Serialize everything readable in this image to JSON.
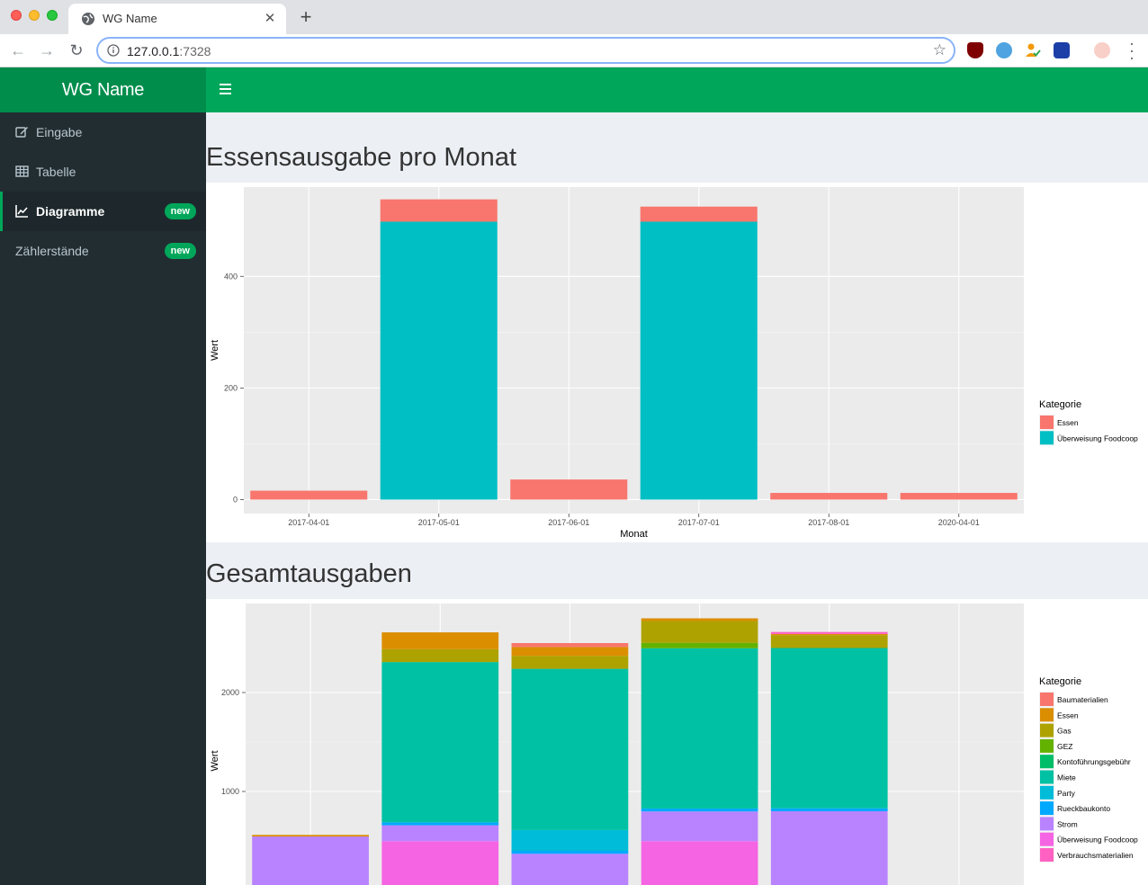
{
  "browser": {
    "tab_title": "WG Name",
    "tab_close": "✕",
    "new_tab": "+",
    "url_host": "127.0.0.1",
    "url_port": ":7328",
    "star": "☆"
  },
  "app": {
    "logo": "WG Name",
    "accent_color": "#00a65a",
    "sidebar_bg": "#222d32"
  },
  "sidebar": {
    "items": [
      {
        "label": "Eingabe",
        "icon": "edit-icon",
        "active": false,
        "badge": ""
      },
      {
        "label": "Tabelle",
        "icon": "table-icon",
        "active": false,
        "badge": ""
      },
      {
        "label": "Diagramme",
        "icon": "line-chart-icon",
        "active": true,
        "badge": "new"
      },
      {
        "label": "Zählerstände",
        "icon": "",
        "active": false,
        "badge": "new"
      }
    ]
  },
  "main": {
    "sections": [
      {
        "title": "Essensausgabe pro Monat"
      },
      {
        "title": "Gesamtausgaben"
      }
    ]
  },
  "chart_data": [
    {
      "type": "bar",
      "stacked": true,
      "title": "",
      "xlabel": "Monat",
      "ylabel": "Wert",
      "categories": [
        "2017-04-01",
        "2017-05-01",
        "2017-06-01",
        "2017-07-01",
        "2017-08-01",
        "2020-04-01"
      ],
      "yticks": [
        0,
        200,
        400
      ],
      "ylim": [
        -25,
        560
      ],
      "grid": true,
      "legend_position": "right",
      "legend_title": "Kategorie",
      "series": [
        {
          "name": "Überweisung Foodcoop",
          "color": "#00bfc4",
          "values": [
            0,
            498,
            0,
            498,
            0,
            0
          ]
        },
        {
          "name": "Essen",
          "color": "#f8766d",
          "values": [
            16,
            40,
            36,
            27,
            12,
            12
          ]
        }
      ]
    },
    {
      "type": "bar",
      "stacked": true,
      "title": "",
      "xlabel": "",
      "ylabel": "Wert",
      "categories": [
        "",
        "",
        "",
        "",
        "",
        ""
      ],
      "yticks": [
        1000,
        2000
      ],
      "ylim": [
        -100,
        2900
      ],
      "grid": true,
      "legend_position": "right",
      "legend_title": "Kategorie",
      "series": [
        {
          "name": "Verbrauchsmaterialien",
          "color": "#ff61c3",
          "values": [
            0,
            0,
            0,
            0,
            0,
            0
          ]
        },
        {
          "name": "Überweisung Foodcoop",
          "color": "#f564e3",
          "values": [
            0,
            498,
            0,
            498,
            0,
            0
          ]
        },
        {
          "name": "Strom",
          "color": "#b983ff",
          "values": [
            0,
            0,
            0,
            0,
            0,
            0
          ]
        },
        {
          "name": "Rueckbaukonto",
          "color": "#00a9ff",
          "values": [
            0,
            0,
            0,
            0,
            0,
            0
          ]
        },
        {
          "name": "Party",
          "color": "#00bcd8",
          "values": [
            0,
            0,
            0,
            0,
            0,
            0
          ]
        },
        {
          "name": "Miete",
          "color": "#00c1a3",
          "values": [
            0,
            0,
            0,
            0,
            0,
            0
          ]
        },
        {
          "name": "Kontoführungsgebühr",
          "color": "#00be67",
          "values": [
            0,
            0,
            0,
            0,
            0,
            0
          ]
        },
        {
          "name": "GEZ",
          "color": "#64b200",
          "values": [
            0,
            0,
            0,
            0,
            0,
            0
          ]
        },
        {
          "name": "Gas",
          "color": "#aea200",
          "values": [
            0,
            0,
            0,
            0,
            0,
            0
          ]
        },
        {
          "name": "Essen",
          "color": "#db8e00",
          "values": [
            0,
            0,
            0,
            0,
            0,
            0
          ]
        },
        {
          "name": "Baumaterialien",
          "color": "#f8766d",
          "values": [
            0,
            0,
            0,
            0,
            0,
            0
          ]
        }
      ],
      "bar_segments": [
        [
          {
            "k": "Strom",
            "v": 545
          },
          {
            "k": "Essen",
            "v": 16
          }
        ],
        [
          {
            "k": "Überweisung Foodcoop",
            "v": 498
          },
          {
            "k": "Strom",
            "v": 160
          },
          {
            "k": "Rueckbaukonto",
            "v": 30
          },
          {
            "k": "Miete",
            "v": 1620
          },
          {
            "k": "Gas",
            "v": 130
          },
          {
            "k": "Essen",
            "v": 170
          }
        ],
        [
          {
            "k": "Strom",
            "v": 370
          },
          {
            "k": "Rueckbaukonto",
            "v": 30
          },
          {
            "k": "Party",
            "v": 210
          },
          {
            "k": "Miete",
            "v": 1630
          },
          {
            "k": "Gas",
            "v": 130
          },
          {
            "k": "Essen",
            "v": 90
          },
          {
            "k": "Baumaterialien",
            "v": 40
          }
        ],
        [
          {
            "k": "Überweisung Foodcoop",
            "v": 498
          },
          {
            "k": "Strom",
            "v": 300
          },
          {
            "k": "Rueckbaukonto",
            "v": 30
          },
          {
            "k": "Miete",
            "v": 1620
          },
          {
            "k": "GEZ",
            "v": 55
          },
          {
            "k": "Gas",
            "v": 220
          },
          {
            "k": "Essen",
            "v": 27
          }
        ],
        [
          {
            "k": "Strom",
            "v": 800
          },
          {
            "k": "Rueckbaukonto",
            "v": 30
          },
          {
            "k": "Miete",
            "v": 1620
          },
          {
            "k": "Gas",
            "v": 130
          },
          {
            "k": "Essen",
            "v": 12
          },
          {
            "k": "Verbrauchsmaterialien",
            "v": 20
          }
        ]
      ]
    }
  ]
}
